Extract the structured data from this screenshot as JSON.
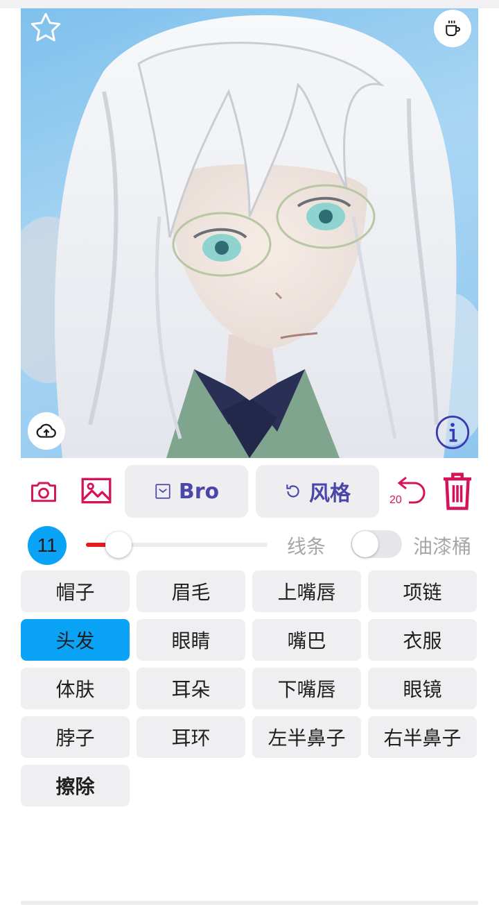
{
  "toolbar": {
    "bro_label": "Bro",
    "style_label": "风格",
    "undo_count": "20"
  },
  "brush": {
    "size": "11",
    "slider_value": 0.18,
    "line_label": "线条",
    "bucket_label": "油漆桶",
    "bucket_enabled": false
  },
  "parts": [
    {
      "label": "帽子",
      "selected": false
    },
    {
      "label": "眉毛",
      "selected": false
    },
    {
      "label": "上嘴唇",
      "selected": false
    },
    {
      "label": "项链",
      "selected": false
    },
    {
      "label": "头发",
      "selected": true
    },
    {
      "label": "眼睛",
      "selected": false
    },
    {
      "label": "嘴巴",
      "selected": false
    },
    {
      "label": "衣服",
      "selected": false
    },
    {
      "label": "体肤",
      "selected": false
    },
    {
      "label": "耳朵",
      "selected": false
    },
    {
      "label": "下嘴唇",
      "selected": false
    },
    {
      "label": "眼镜",
      "selected": false
    },
    {
      "label": "脖子",
      "selected": false
    },
    {
      "label": "耳环",
      "selected": false
    },
    {
      "label": "左半鼻子",
      "selected": false
    },
    {
      "label": "右半鼻子",
      "selected": false
    },
    {
      "label": "擦除",
      "selected": false
    }
  ],
  "colors": {
    "accent_blue": "#0aa3f5",
    "icon_red": "#d4145a",
    "button_text_indigo": "#4a47a8",
    "slider_red": "#e21b1b"
  },
  "icons": {
    "favorite": "star-icon",
    "coffee": "coffee-cup-icon",
    "upload": "cloud-upload-icon",
    "info": "info-icon",
    "camera": "camera-icon",
    "gallery": "image-icon",
    "bro": "envelope-check-icon",
    "style": "refresh-icon",
    "undo": "undo-icon",
    "delete": "trash-icon"
  }
}
